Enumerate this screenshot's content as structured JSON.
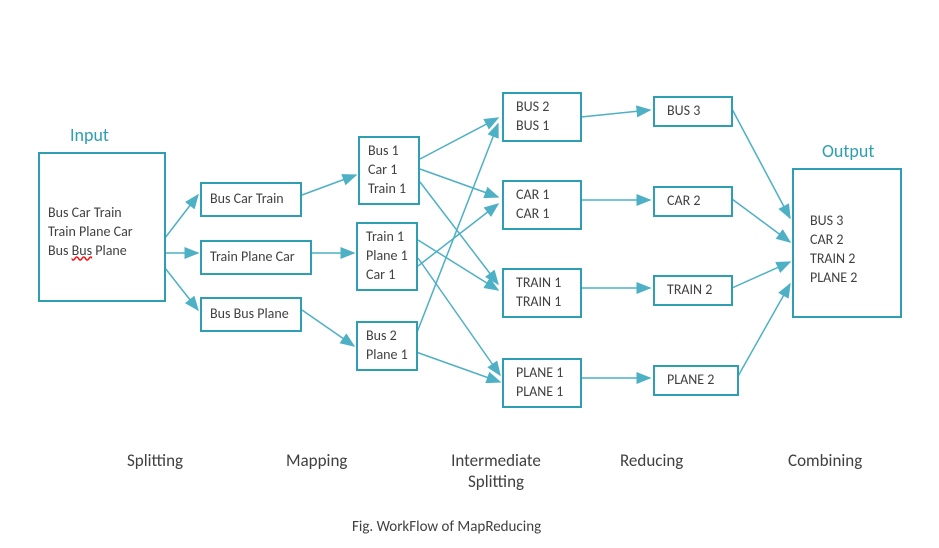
{
  "labels": {
    "input": "Input",
    "output": "Output"
  },
  "stages": {
    "splitting": "Splitting",
    "mapping": "Mapping",
    "intermediate": "Intermediate\nSplitting",
    "reducing": "Reducing",
    "combining": "Combining"
  },
  "caption": "Fig. WorkFlow of MapReducing",
  "input": {
    "l1": "Bus Car Train",
    "l2": "Train Plane Car",
    "l3a": "Bus ",
    "l3b": "Bus",
    "l3c": " Plane"
  },
  "split": {
    "s1": "Bus Car Train",
    "s2": "Train Plane Car",
    "s3": "Bus Bus Plane"
  },
  "map": {
    "m1a": "Bus 1",
    "m1b": "Car 1",
    "m1c": "Train 1",
    "m2a": "Train 1",
    "m2b": "Plane 1",
    "m2c": "Car 1",
    "m3a": "Bus 2",
    "m3b": "Plane 1"
  },
  "inter": {
    "i1a": "BUS  2",
    "i1b": "BUS  1",
    "i2a": "CAR  1",
    "i2b": "CAR  1",
    "i3a": "TRAIN  1",
    "i3b": "TRAIN  1",
    "i4a": "PLANE  1",
    "i4b": "PLANE  1"
  },
  "reduce": {
    "r1": "BUS  3",
    "r2": "CAR   2",
    "r3": "TRAIN  2",
    "r4": "PLANE  2"
  },
  "output": {
    "l1": "BUS  3",
    "l2": "CAR  2",
    "l3": "TRAIN  2",
    "l4": "PLANE  2"
  }
}
